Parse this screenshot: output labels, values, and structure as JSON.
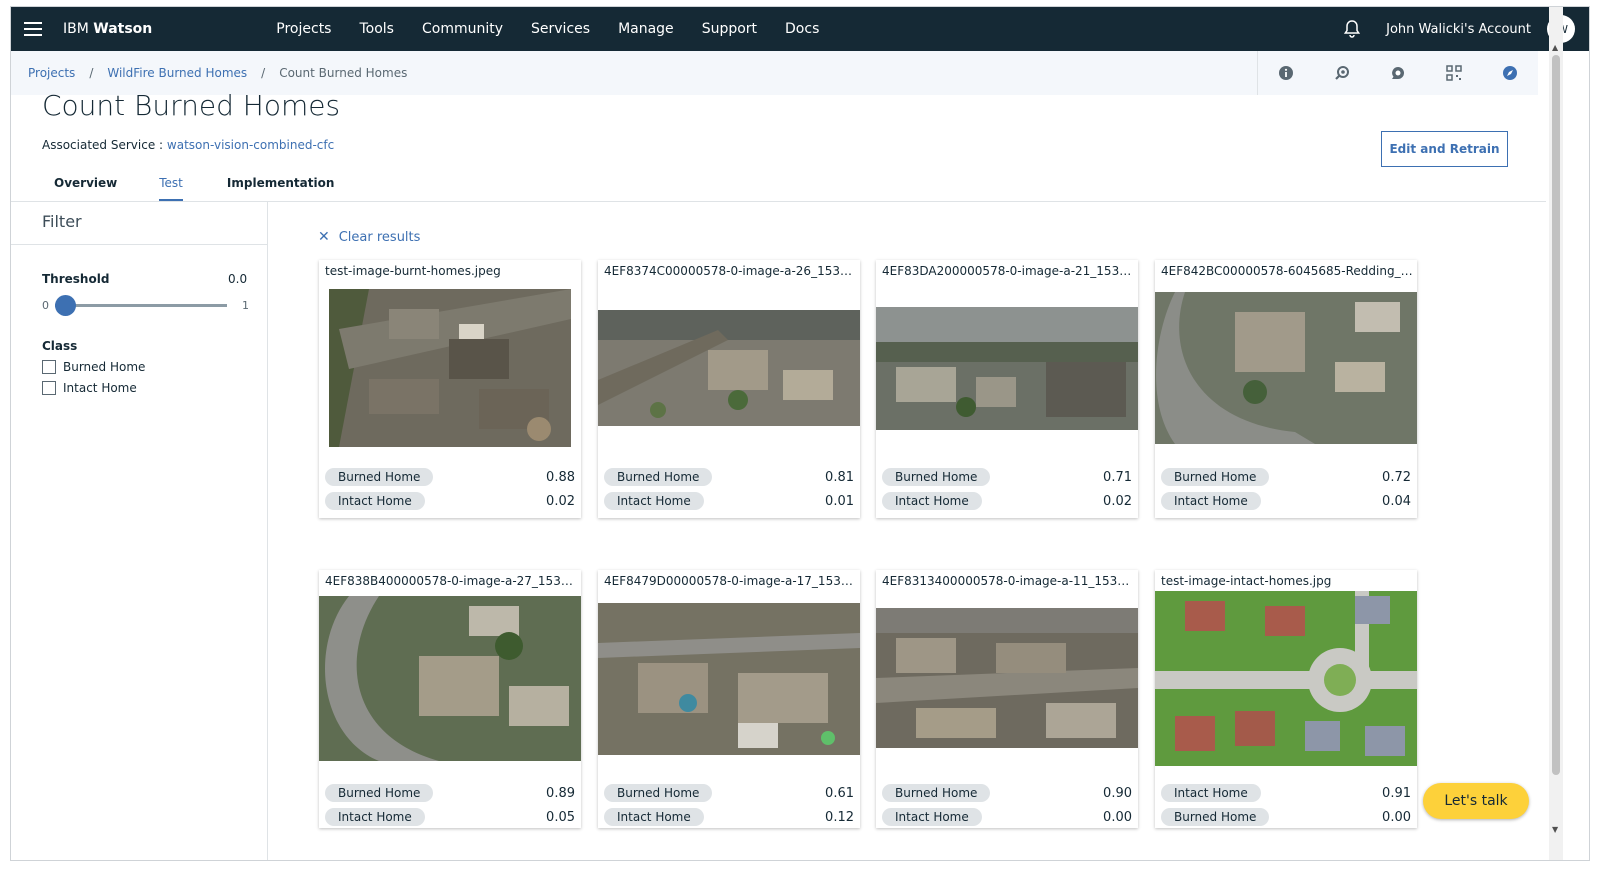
{
  "nav": {
    "brand_prefix": "IBM",
    "brand_name": "Watson",
    "links": [
      "Projects",
      "Tools",
      "Community",
      "Services",
      "Manage",
      "Support",
      "Docs"
    ],
    "account": "John Walicki's Account",
    "avatar_initials": "JW"
  },
  "breadcrumb": {
    "items": [
      "Projects",
      "WildFire Burned Homes"
    ],
    "separator": "/",
    "current": "Count Burned Homes"
  },
  "tool_icons": [
    "info-icon",
    "api-reference-icon",
    "chat-support-icon",
    "grid-apps-icon",
    "compass-icon"
  ],
  "header": {
    "title": "Count Burned Homes",
    "assoc_label": "Associated Service :",
    "assoc_service": "watson-vision-combined-cfc",
    "edit_button": "Edit and Retrain"
  },
  "tabs": [
    {
      "label": "Overview",
      "active": false
    },
    {
      "label": "Test",
      "active": true
    },
    {
      "label": "Implementation",
      "active": false
    }
  ],
  "filter": {
    "title": "Filter",
    "threshold_label": "Threshold",
    "threshold_value": "0.0",
    "slider_min": "0",
    "slider_max": "1",
    "threshold_level": 0.0,
    "class_label": "Class",
    "classes": [
      "Burned Home",
      "Intact Home"
    ]
  },
  "results": {
    "clear_label": "Clear results",
    "cards": [
      {
        "filename": "test-image-burnt-homes.jpeg",
        "rows": [
          {
            "label": "Burned Home",
            "score": "0.88"
          },
          {
            "label": "Intact Home",
            "score": "0.02"
          }
        ]
      },
      {
        "filename": "4EF8374C00000578-0-image-a-26_1533…",
        "rows": [
          {
            "label": "Burned Home",
            "score": "0.81"
          },
          {
            "label": "Intact Home",
            "score": "0.01"
          }
        ]
      },
      {
        "filename": "4EF83DA200000578-0-image-a-21_153…",
        "rows": [
          {
            "label": "Burned Home",
            "score": "0.71"
          },
          {
            "label": "Intact Home",
            "score": "0.02"
          }
        ]
      },
      {
        "filename": "4EF842BC00000578-6045685-Redding_i…",
        "rows": [
          {
            "label": "Burned Home",
            "score": "0.72"
          },
          {
            "label": "Intact Home",
            "score": "0.04"
          }
        ]
      },
      {
        "filename": "4EF838B400000578-0-image-a-27_1533…",
        "rows": [
          {
            "label": "Burned Home",
            "score": "0.89"
          },
          {
            "label": "Intact Home",
            "score": "0.05"
          }
        ]
      },
      {
        "filename": "4EF8479D00000578-0-image-a-17_153…",
        "rows": [
          {
            "label": "Burned Home",
            "score": "0.61"
          },
          {
            "label": "Intact Home",
            "score": "0.12"
          }
        ]
      },
      {
        "filename": "4EF8313400000578-0-image-a-11_1533…",
        "rows": [
          {
            "label": "Burned Home",
            "score": "0.90"
          },
          {
            "label": "Intact Home",
            "score": "0.00"
          }
        ]
      },
      {
        "filename": "test-image-intact-homes.jpg",
        "rows": [
          {
            "label": "Intact Home",
            "score": "0.91"
          },
          {
            "label": "Burned Home",
            "score": "0.00"
          }
        ]
      }
    ]
  },
  "chat_button": "Let's talk",
  "colors": {
    "nav_bg": "#152935",
    "accent": "#3d70b2",
    "tag_bg": "#dfe3e6",
    "chat_bg": "#fdd13a"
  }
}
